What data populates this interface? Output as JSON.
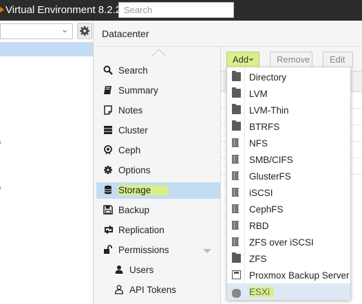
{
  "header": {
    "app_title": "Virtual Environment 8.2.2",
    "search_placeholder": "Search"
  },
  "tree": {
    "fragments": [
      ")",
      ")"
    ]
  },
  "content": {
    "title": "Datacenter"
  },
  "subnav": {
    "items": [
      {
        "label": "Search",
        "icon": "search-icon"
      },
      {
        "label": "Summary",
        "icon": "book-icon"
      },
      {
        "label": "Notes",
        "icon": "note-icon"
      },
      {
        "label": "Cluster",
        "icon": "server-icon"
      },
      {
        "label": "Ceph",
        "icon": "ceph-icon"
      },
      {
        "label": "Options",
        "icon": "gear-icon"
      },
      {
        "label": "Storage",
        "icon": "database-icon"
      },
      {
        "label": "Backup",
        "icon": "floppy-icon"
      },
      {
        "label": "Replication",
        "icon": "retweet-icon"
      },
      {
        "label": "Permissions",
        "icon": "unlock-icon"
      },
      {
        "label": "Users",
        "icon": "user-icon"
      },
      {
        "label": "API Tokens",
        "icon": "user-outline-icon"
      }
    ]
  },
  "toolbar": {
    "add_label": "Add",
    "remove_label": "Remove",
    "edit_label": "Edit"
  },
  "add_menu": {
    "items": [
      {
        "label": "Directory",
        "icon": "folder-icon"
      },
      {
        "label": "LVM",
        "icon": "folder-icon"
      },
      {
        "label": "LVM-Thin",
        "icon": "folder-icon"
      },
      {
        "label": "BTRFS",
        "icon": "folder-icon"
      },
      {
        "label": "NFS",
        "icon": "building-icon"
      },
      {
        "label": "SMB/CIFS",
        "icon": "building-icon"
      },
      {
        "label": "GlusterFS",
        "icon": "building-icon"
      },
      {
        "label": "iSCSI",
        "icon": "building-icon"
      },
      {
        "label": "CephFS",
        "icon": "building-icon"
      },
      {
        "label": "RBD",
        "icon": "building-icon"
      },
      {
        "label": "ZFS over iSCSI",
        "icon": "building-icon"
      },
      {
        "label": "ZFS",
        "icon": "folder-icon"
      },
      {
        "label": "Proxmox Backup Server",
        "icon": "floppy-icon"
      },
      {
        "label": "ESXi",
        "icon": "cloud-download-icon"
      }
    ]
  },
  "colors": {
    "selection_blue": "#c3dcf2",
    "highlight_green": "#d9f08a",
    "topbar": "#2c2c2c"
  }
}
